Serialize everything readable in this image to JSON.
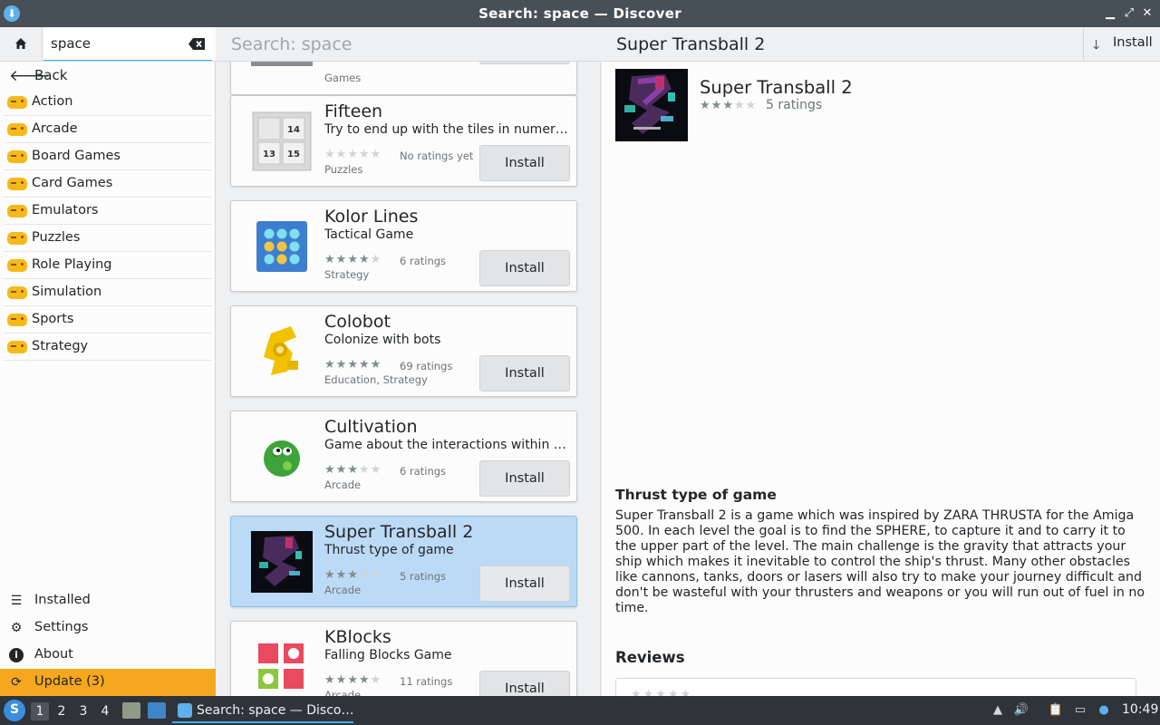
{
  "window": {
    "title": "Search: space — Discover",
    "minimize_glyph": "▁",
    "maximize_glyph": "⤢",
    "close_glyph": "✕"
  },
  "sidebar": {
    "search_value": "space",
    "back_label": "Back",
    "categories": [
      "Action",
      "Arcade",
      "Board Games",
      "Card Games",
      "Emulators",
      "Puzzles",
      "Role Playing",
      "Simulation",
      "Sports",
      "Strategy"
    ],
    "bottom": {
      "installed": "Installed",
      "settings": "Settings",
      "about": "About",
      "update": "Update (3)"
    }
  },
  "list": {
    "search_placeholder": "Search: space",
    "partial_top": {
      "category": "Games",
      "install": "Install"
    },
    "apps": [
      {
        "name": "Fifteen",
        "description": "Try to end up with the tiles in numerical order",
        "rating_stars": 0,
        "ratings": "No ratings yet",
        "categories": "Puzzles",
        "install": "Install",
        "icon": "fifteen-puzzle-icon"
      },
      {
        "name": "Kolor Lines",
        "description": "Tactical Game",
        "rating_stars": 4,
        "ratings": "6 ratings",
        "categories": "Strategy",
        "install": "Install",
        "icon": "kolor-lines-icon"
      },
      {
        "name": "Colobot",
        "description": "Colonize with bots",
        "rating_stars": 5,
        "ratings": "69 ratings",
        "categories": "Education, Strategy",
        "install": "Install",
        "icon": "colobot-icon"
      },
      {
        "name": "Cultivation",
        "description": "Game about the interactions within a gardening community",
        "rating_stars": 3,
        "ratings": "6 ratings",
        "categories": "Arcade",
        "install": "Install",
        "icon": "cultivation-icon"
      },
      {
        "name": "Super Transball 2",
        "description": "Thrust type of game",
        "rating_stars": 3,
        "ratings": "5 ratings",
        "categories": "Arcade",
        "install": "Install",
        "icon": "transball-icon",
        "selected": true
      },
      {
        "name": "KBlocks",
        "description": "Falling Blocks Game",
        "rating_stars": 4,
        "ratings": "11 ratings",
        "categories": "Arcade",
        "install": "Install",
        "icon": "kblocks-icon"
      }
    ]
  },
  "detail": {
    "header_title": "Super Transball 2",
    "header_install": "Install",
    "name": "Super Transball 2",
    "rating_stars": 3,
    "ratings": "5 ratings",
    "summary": "Thrust type of game",
    "description": "Super Transball 2 is a game which was inspired by ZARA THRUSTA for the Amiga 500. In each level the goal is to find the SPHERE, to capture it and to carry it to the upper part of the level. The main challenge is the gravity that attracts your ship which makes it inevitable to control the ship's thrust. Many other obstacles like cannons, tanks, doors or lasers will also try to make your journey difficult and don't be wasteful with your thrusters and weapons or you will run out of fuel in no time.",
    "reviews_heading": "Reviews"
  },
  "taskbar": {
    "desktops": [
      "1",
      "2",
      "3",
      "4"
    ],
    "active_desktop": "1",
    "task_label": "Search: space — Disco…",
    "clock": "10:49"
  },
  "colors": {
    "accent": "#3daee9",
    "selected_card": "#bbdaf5",
    "update_bar": "#f6a720",
    "titlebar": "#475057",
    "taskbar": "#2f343a"
  }
}
